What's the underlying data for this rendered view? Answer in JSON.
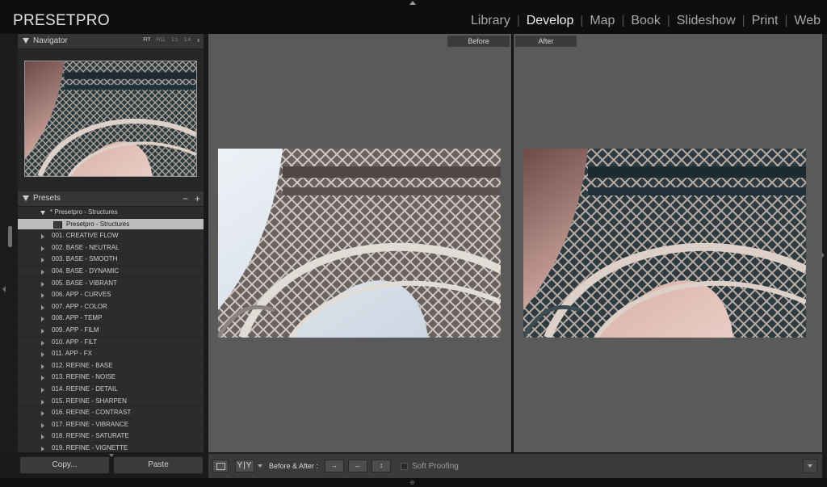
{
  "app": {
    "brand": "PRESETPRO"
  },
  "modules": [
    "Library",
    "Develop",
    "Map",
    "Book",
    "Slideshow",
    "Print",
    "Web"
  ],
  "active_module": "Develop",
  "navigator": {
    "title": "Navigator",
    "modes": [
      "FIT",
      "FILL",
      "1:1",
      "1:4"
    ],
    "active_mode": "FIT",
    "more_glyph": "⬍"
  },
  "presets": {
    "title": "Presets",
    "remove_glyph": "−",
    "add_glyph": "+",
    "open_folder": "* Presetpro - Structures",
    "selected_preset": "Presetpro - Structures",
    "folders": [
      "001. CREATIVE FLOW",
      "002. BASE - NEUTRAL",
      "003. BASE - SMOOTH",
      "004. BASE - DYNAMIC",
      "005. BASE - VIBRANT",
      "006. APP - CURVES",
      "007. APP - COLOR",
      "008. APP - TEMP",
      "009. APP - FILM",
      "010. APP - FILT",
      "011. APP - FX",
      "012. REFINE - BASE",
      "013. REFINE - NOISE",
      "014. REFINE - DETAIL",
      "015. REFINE - SHARPEN",
      "016. REFINE - CONTRAST",
      "017. REFINE - VIBRANCE",
      "018. REFINE - SATURATE",
      "019. REFINE - VIGNETTE"
    ]
  },
  "buttons": {
    "copy": "Copy...",
    "paste": "Paste"
  },
  "view": {
    "before_label": "Before",
    "after_label": "After"
  },
  "toolbar": {
    "yy_label": "Y|Y",
    "before_after_label": "Before & After :",
    "swap1": "→",
    "swap2": "←",
    "swap3": "↕",
    "soft_proofing": "Soft Proofing"
  },
  "colors": {
    "accent_text": "#f0f0f0",
    "panel_bg": "#2c2c2c",
    "view_bg": "#5a5a5a"
  }
}
